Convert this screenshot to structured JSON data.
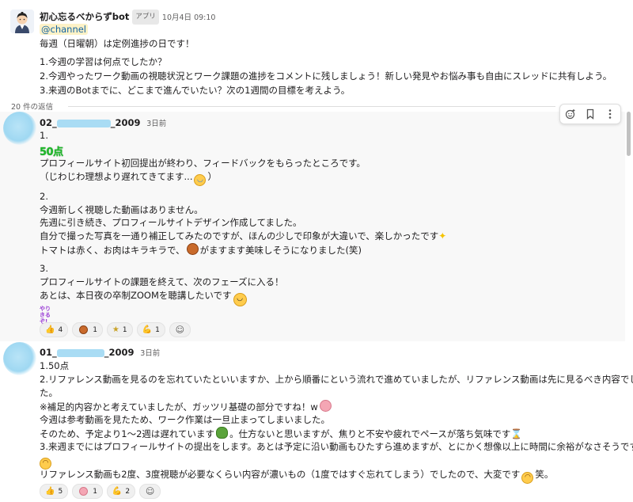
{
  "header": {
    "bot_name": "初心忘るべからずbot",
    "app_badge": "アプリ",
    "timestamp": "10月4日 09:10",
    "mention": "@channel",
    "lines": [
      "毎週（日曜朝）は定例進捗の日です！",
      "1.今週の学習は何点でしたか？",
      "2.今週やったワーク動画の視聴状況とワーク課題の進捗をコメントに残しましょう！新しい発見やお悩み事も自由にスレッドに共有しよう。",
      "3.来週のBotまでに、どこまで進んでいたい？次の1週間の目標を考えよう。"
    ]
  },
  "thread": {
    "reply_count_label": "20 件の返信"
  },
  "toolbar": {
    "icons": [
      "emoji-add-icon",
      "bookmark-icon",
      "more-icon"
    ]
  },
  "reply1": {
    "name_prefix": "02_",
    "name_suffix": "_2009",
    "time": "3日前",
    "score_sticker": "50点",
    "lines": {
      "l1": "1.",
      "l2": "プロフィールサイト初回提出が終わり、フィードバックをもらったところです。",
      "l3a": "（じわじわ理想より遅れてきてます...",
      "l3b": "）",
      "l4": "2.",
      "l5": "今週新しく視聴した動画はありません。",
      "l6": "先週に引き続き、プロフィールサイトデザイン作成してました。",
      "l7": "自分で撮った写真を一通り補正してみたのですが、ほんの少しで印象が大違いで、楽しかったです",
      "l8a": "トマトは赤く、お肉はキラキラで、",
      "l8b": "がますます美味しそうになりました(笑)",
      "l9": "3.",
      "l10": "プロフィールサイトの課題を終えて、次のフェーズに入る！",
      "l11": "あとは、本日夜の卒制ZOOMを聴講したいです"
    },
    "sticker_text": "やりきるぞ!",
    "reactions": [
      {
        "icon": "thumbs-up-icon",
        "count": "4"
      },
      {
        "icon": "hamburger-icon",
        "count": "1"
      },
      {
        "icon": "star-icon",
        "count": "1"
      },
      {
        "icon": "flexed-biceps-icon",
        "count": "1"
      }
    ]
  },
  "reply2": {
    "name_prefix": "01_",
    "name_suffix": "_2009",
    "time": "3日前",
    "lines": {
      "l1": "1.50点",
      "l2": "2.リファレンス動画を見るのを忘れていたといいますか、上から順番にという流れで進めていましたが、リファレンス動画は先に見るべき内容でし",
      "l3": "た。",
      "l4": "※補足的内容かと考えていましたが、ガッツリ基礎の部分ですね！w",
      "l5": "今週は参考動画を見たため、ワーク作業は一旦止まってしまいました。",
      "l6a": "そのため、予定より1〜2週は遅れています",
      "l6b": "。仕方ないと思いますが、焦りと不安や疲れでペースが落ち気味です",
      "l7": "3.来週までにはプロフィールサイトの提出をします。あとは予定に沿い動画もひたすら進めますが、とにかく想像以上に時間に余裕がなさそうです",
      "l9a": "リファレンス動画も2度、3度視聴が必要なくらい内容が濃いもの（1度ではすぐ忘れてしまう）でしたので、大変です",
      "l9b": "笑。"
    },
    "reactions": [
      {
        "icon": "thumbs-up-icon",
        "count": "5"
      },
      {
        "icon": "brain-icon",
        "count": "1"
      },
      {
        "icon": "flexed-biceps-icon",
        "count": "2"
      }
    ]
  }
}
